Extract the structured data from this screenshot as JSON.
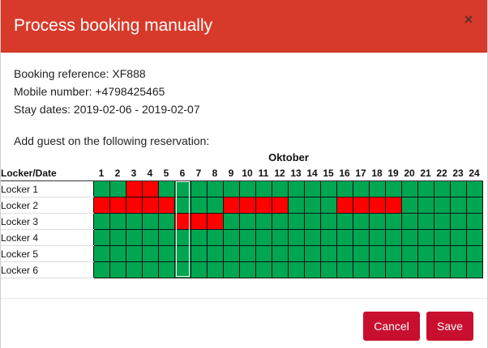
{
  "header": {
    "title": "Process booking manually"
  },
  "info": {
    "reference": "Booking reference: XF888",
    "mobile": "Mobile number: +4798425465",
    "stay": "Stay dates: 2019-02-06 - 2019-02-07"
  },
  "add_guest_label": "Add guest on the following reservation:",
  "grid": {
    "month": "Oktober",
    "first_col_header": "Locker/Date",
    "days": [
      "1",
      "2",
      "3",
      "4",
      "5",
      "6",
      "7",
      "8",
      "9",
      "10",
      "11",
      "12",
      "13",
      "14",
      "15",
      "16",
      "17",
      "18",
      "19",
      "20",
      "21",
      "22",
      "23",
      "24"
    ],
    "lockers": [
      {
        "name": "Locker 1",
        "booked": [
          3,
          4
        ]
      },
      {
        "name": "Locker 2",
        "booked": [
          1,
          2,
          3,
          4,
          5,
          9,
          10,
          11,
          12,
          16,
          17,
          18,
          19
        ]
      },
      {
        "name": "Locker 3",
        "booked": [
          6,
          7,
          8
        ]
      },
      {
        "name": "Locker 4",
        "booked": []
      },
      {
        "name": "Locker 5",
        "booked": []
      },
      {
        "name": "Locker 6",
        "booked": []
      }
    ],
    "colors": {
      "free": "#00a651",
      "booked": "#ff0000"
    }
  },
  "buttons": {
    "cancel": "Cancel",
    "save": "Save"
  }
}
